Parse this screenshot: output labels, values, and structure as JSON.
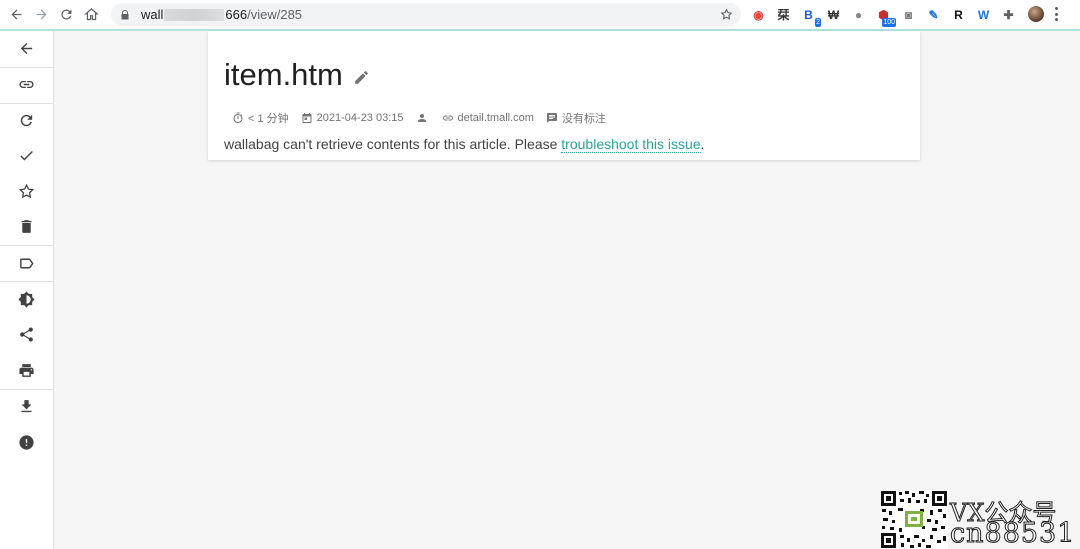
{
  "browser": {
    "url_host_start": "wall",
    "url_host_end": "666",
    "url_path": "/view/285",
    "extensions": [
      {
        "name": "color-wheel-ext-icon",
        "glyph": "◉",
        "color": "#e8453c"
      },
      {
        "name": "chinese-ext-icon",
        "glyph": "栞",
        "color": "#333333"
      },
      {
        "name": "bitwarden-ext-icon",
        "glyph": "B",
        "color": "#175ddc",
        "badge": "2"
      },
      {
        "name": "w-ext-icon",
        "glyph": "₩",
        "color": "#333333"
      },
      {
        "name": "puzzle-leaf-ext-icon",
        "glyph": "●",
        "color": "#888888"
      },
      {
        "name": "ublock-ext-icon",
        "glyph": "⬢",
        "color": "#c4302b",
        "badge": "100"
      },
      {
        "name": "camera-ext-icon",
        "glyph": "◙",
        "color": "#777777"
      },
      {
        "name": "blue-pen-ext-icon",
        "glyph": "✎",
        "color": "#1a73e8"
      },
      {
        "name": "r-ext-icon",
        "glyph": "R",
        "color": "#111111"
      },
      {
        "name": "w-blue-ext-icon",
        "glyph": "W",
        "color": "#1a73e8"
      },
      {
        "name": "extensions-puzzle-icon",
        "glyph": "✚",
        "color": "#5f6368"
      }
    ]
  },
  "article": {
    "title": "item.htm",
    "reading_time": "< 1 分钟",
    "date": "2021-04-23 03:15",
    "domain": "detail.tmall.com",
    "annotations": "没有标注",
    "body_prefix": "wallabag can't retrieve contents for this article. Please ",
    "body_link": "troubleshoot this issue",
    "body_suffix": "."
  },
  "watermark": {
    "line1": "VX公众号",
    "line2": "cn88531"
  },
  "colors": {
    "accent": "#26a69a",
    "accent_line": "#b2e2e2"
  }
}
